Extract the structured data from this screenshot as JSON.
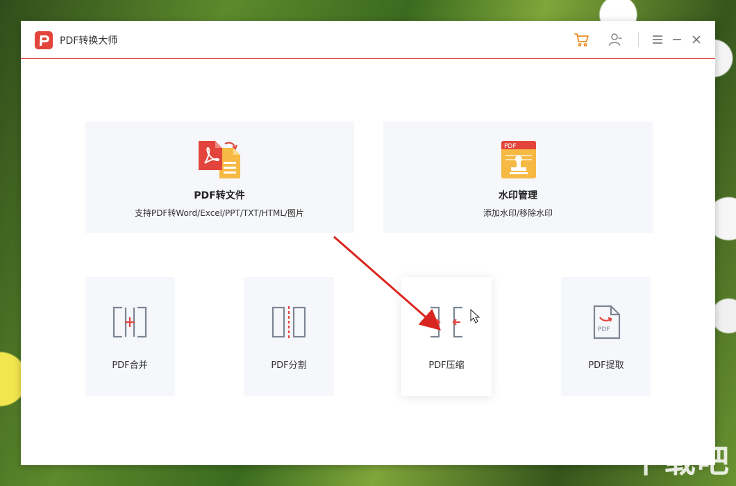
{
  "window": {
    "title": "PDF转换大师",
    "icons": {
      "logo": "pdf-logo-icon",
      "cart": "cart-icon",
      "user": "user-icon",
      "menu": "menu-icon",
      "minimize": "minimize-icon",
      "close": "close-icon"
    },
    "accent_color": "#e3443b"
  },
  "features": {
    "convert": {
      "title": "PDF转文件",
      "desc": "支持PDF转Word/Excel/PPT/TXT/HTML/图片",
      "icon": "pdf-to-file-icon"
    },
    "watermark": {
      "title": "水印管理",
      "desc": "添加水印/移除水印",
      "icon": "watermark-stamp-icon",
      "badge": "PDF"
    }
  },
  "tools": [
    {
      "label": "PDF合并",
      "icon": "merge-icon"
    },
    {
      "label": "PDF分割",
      "icon": "split-icon"
    },
    {
      "label": "PDF压缩",
      "icon": "compress-icon"
    },
    {
      "label": "PDF提取",
      "icon": "extract-icon",
      "badge": "PDF"
    }
  ],
  "site_watermark": "下载吧"
}
